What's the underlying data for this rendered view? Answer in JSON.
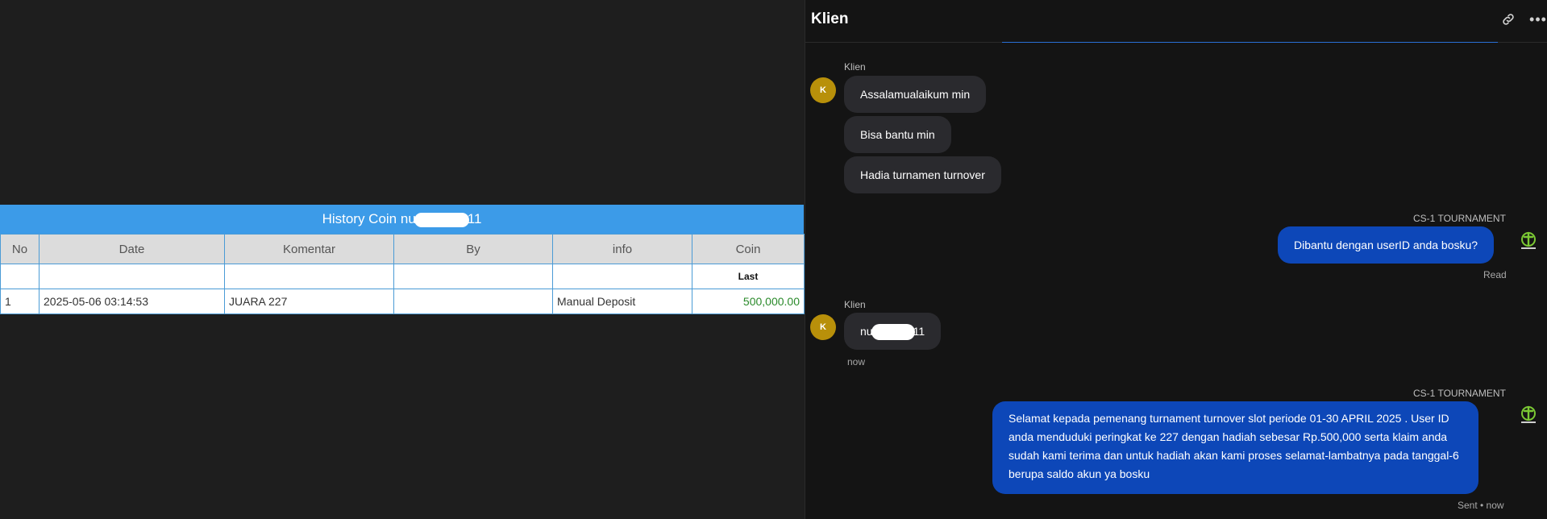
{
  "history": {
    "title_prefix": "History Coin nu",
    "title_suffix": "11",
    "columns": [
      "No",
      "Date",
      "Komentar",
      "By",
      "info",
      "Coin"
    ],
    "subheader_coin": "Last",
    "rows": [
      {
        "no": "1",
        "date": "2025-05-06 03:14:53",
        "komentar": "JUARA 227",
        "by": "",
        "info": "Manual Deposit",
        "coin": "500,000.00"
      }
    ]
  },
  "chat": {
    "title": "Klien",
    "messages": {
      "m1_sender": "Klien",
      "m1_avatar": "K",
      "m1_lines": [
        "Assalamualaikum min",
        "Bisa bantu min",
        "Hadia turnamen turnover"
      ],
      "m2_sender": "CS-1 TOURNAMENT",
      "m2_text": "Dibantu dengan userID anda bosku?",
      "m2_status": "Read",
      "m3_sender": "Klien",
      "m3_avatar": "K",
      "m3_prefix": "nu",
      "m3_suffix": "11",
      "m3_time": "now",
      "m4_sender": "CS-1 TOURNAMENT",
      "m4_text": "Selamat kepada pemenang turnament turnover slot periode 01-30 APRIL 2025 . User ID anda menduduki peringkat ke 227 dengan hadiah sebesar Rp.500,000 serta klaim anda sudah kami terima dan untuk hadiah akan kami proses selamat-lambatnya pada tanggal-6 berupa saldo akun ya bosku",
      "m4_status": "Sent • now"
    }
  },
  "icons": {
    "header_link": "link-icon",
    "header_more": "more-horizontal-icon",
    "bot_logo": "tournament-logo-icon"
  },
  "colors": {
    "table_header": "#3c9be8",
    "outgoing_bubble": "#0d47b8",
    "incoming_bubble": "#2a2a2e",
    "avatar": "#b8900a",
    "coin_value": "#2b8a2b"
  }
}
